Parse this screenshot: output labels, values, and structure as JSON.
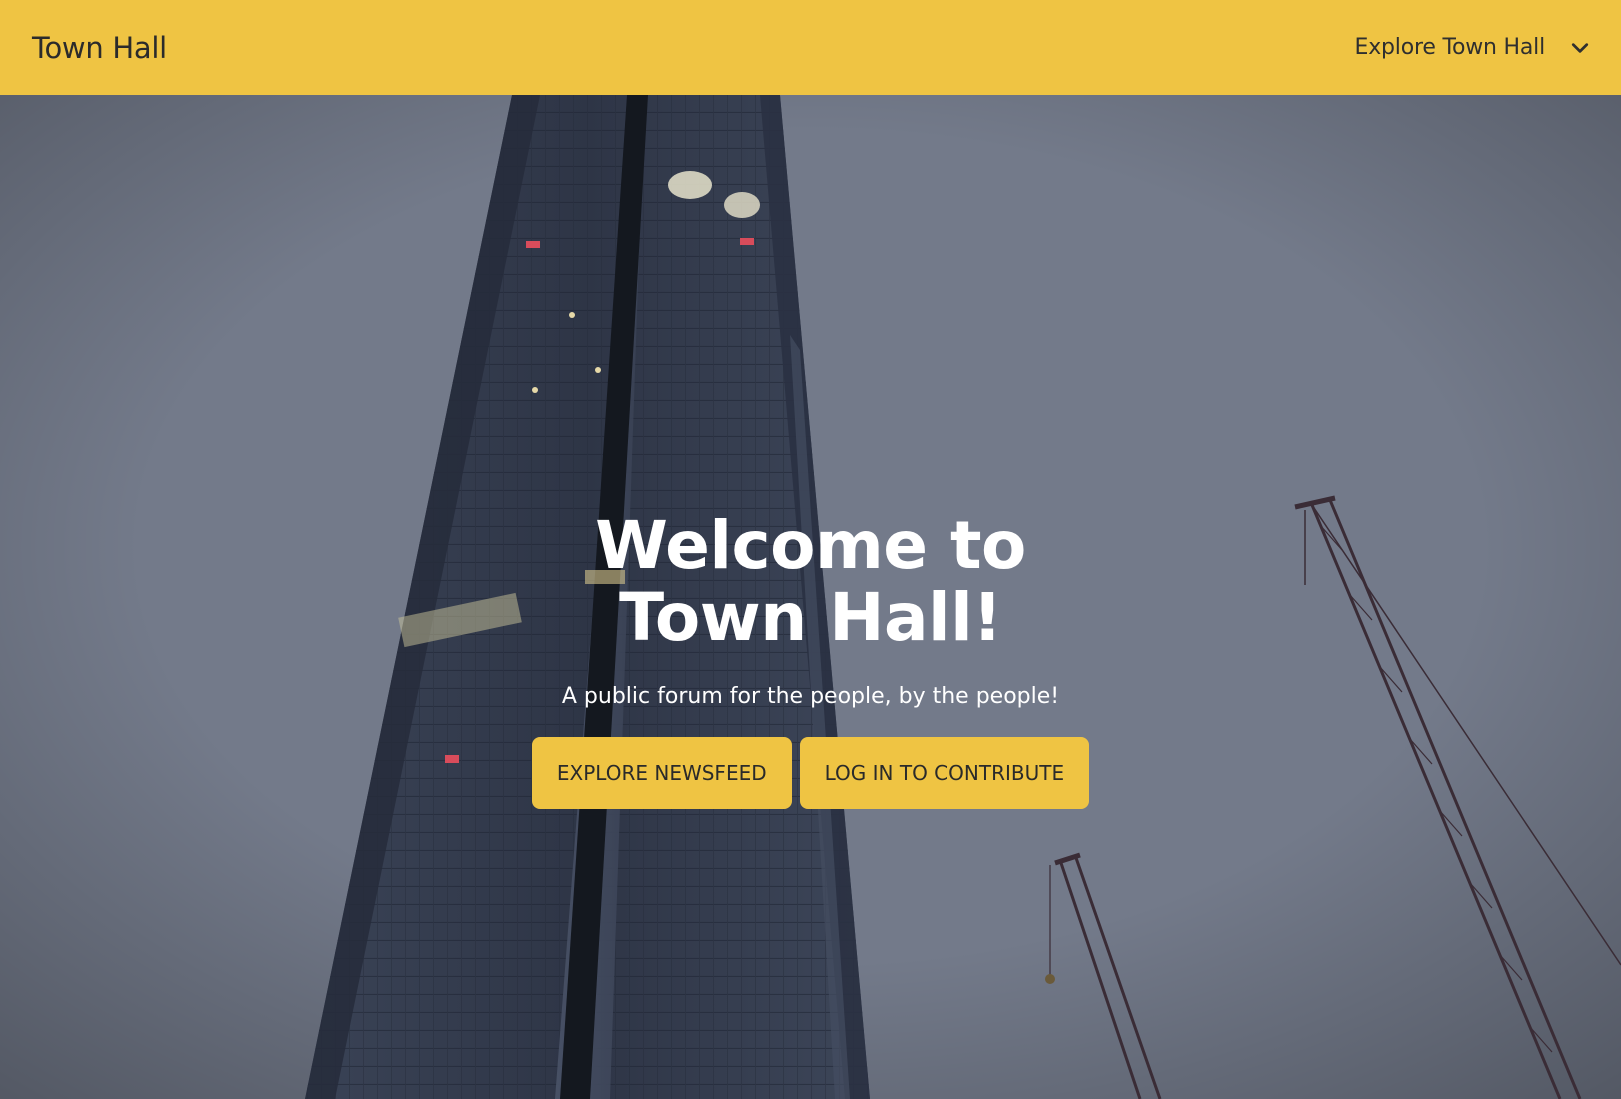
{
  "navbar": {
    "brand": "Town Hall",
    "dropdown_label": "Explore Town Hall",
    "dropdown_icon": "chevron-down-icon",
    "background_color": "#efc443"
  },
  "hero": {
    "title": "Welcome to Town Hall!",
    "subtitle": "A public forum for the people, by the people!",
    "buttons": {
      "explore_newsfeed": "EXPLORE NEWSFEED",
      "login": "LOG IN TO CONTRIBUTE"
    },
    "background_image": "skyscraper-and-cranes-photo"
  },
  "colors": {
    "accent": "#efc443",
    "hero_text": "#ffffff"
  }
}
